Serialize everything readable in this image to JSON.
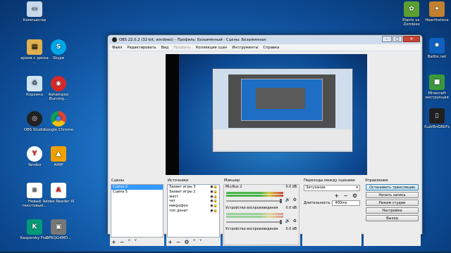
{
  "desktop": {
    "left_icons": [
      {
        "label": "Компьютер",
        "icon": "computer-icon",
        "color": "#c8d8e8"
      },
      {
        "label": "архив с диска ...",
        "icon": "archive-icon",
        "color": "#e0b050"
      },
      {
        "label": "Skype",
        "icon": "skype-icon",
        "color": "#00a8e8"
      },
      {
        "label": "Корзина",
        "icon": "recycle-bin-icon",
        "color": "#cfe3f2"
      },
      {
        "label": "Ashampoo Burning...",
        "icon": "ashampoo-icon",
        "color": "#d62828"
      },
      {
        "label": "OBS Studio",
        "icon": "obs-icon",
        "color": "#222222"
      },
      {
        "label": "Google Chrome",
        "icon": "chrome-icon",
        "color": "#f2c200"
      },
      {
        "label": "Yandex",
        "icon": "yandex-icon",
        "color": "#ffffff"
      },
      {
        "label": "AIMP",
        "icon": "aimp-icon",
        "color": "#f0a000"
      },
      {
        "label": "Новый текстовый...",
        "icon": "text-file-icon",
        "color": "#ffffff"
      },
      {
        "label": "Adobe Reader XI",
        "icon": "pdf-icon",
        "color": "#e02020"
      },
      {
        "label": "Kaspersky Free",
        "icon": "kaspersky-icon",
        "color": "#009a77"
      },
      {
        "label": "ZPRQG4MD...",
        "icon": "image-file-icon",
        "color": "#777777"
      }
    ],
    "right_icons": [
      {
        "label": "Plants vs. Zombies",
        "icon": "plants-icon",
        "color": "#5aa030"
      },
      {
        "label": "Hearthstone",
        "icon": "hearthstone-icon",
        "color": "#c08030"
      },
      {
        "label": "Battle.net",
        "icon": "battlenet-icon",
        "color": "#1060c0"
      },
      {
        "label": "Minecraft инструкция",
        "icon": "minecraft-icon",
        "color": "#3c9a3c"
      },
      {
        "label": "fLuIrBnGRkFs",
        "icon": "file-icon",
        "color": "#202020"
      }
    ]
  },
  "window": {
    "title": "OBS 22.0.2 (32-bit, windows) - Профиль: Безымянный - Сцены: Безымянная",
    "menu": [
      "Файл",
      "Редактировать",
      "Вид",
      "Профиль",
      "Коллекция сцен",
      "Инструменты",
      "Справка"
    ],
    "menu_disabled_index": 3
  },
  "docks": {
    "scenes": {
      "title": "Сцены",
      "items": [
        "Сцена 2",
        "Сцена 5"
      ],
      "selected": 0
    },
    "sources": {
      "title": "Источники",
      "items": [
        "Захват игры 3",
        "Захват игры 2",
        "жест",
        "чат",
        "микрофон",
        "топ донат"
      ]
    },
    "mixer": {
      "title": "Микшер",
      "channels": [
        {
          "name": "Mic/Aux 2",
          "db": "0.0 dB"
        },
        {
          "name": "Устройство воспроизведения",
          "db": "0.0 dB"
        },
        {
          "name": "Устройство воспроизведения",
          "db": "0.0 dB"
        }
      ]
    },
    "transitions": {
      "title": "Переходы между сценами",
      "selected": "Затухание",
      "duration_label": "Длительность",
      "duration": "400ms"
    },
    "controls": {
      "title": "Управление",
      "buttons": [
        "Остановить трансляцию",
        "Начать запись",
        "Режим студии",
        "Настройки",
        "Выход"
      ]
    }
  }
}
